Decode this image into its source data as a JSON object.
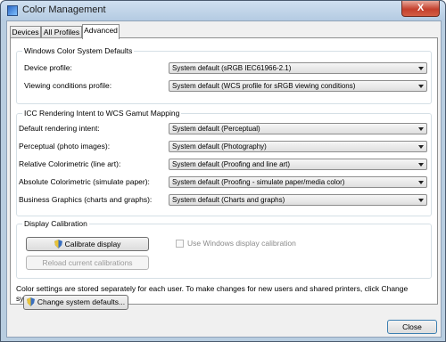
{
  "window": {
    "title": "Color Management",
    "close_glyph": "X"
  },
  "tabs": [
    {
      "label": "Devices"
    },
    {
      "label": "All Profiles"
    },
    {
      "label": "Advanced"
    }
  ],
  "wcs_defaults": {
    "title": "Windows Color System Defaults",
    "device_profile": {
      "label": "Device profile:",
      "value": "System default (sRGB IEC61966-2.1)"
    },
    "viewing_conditions": {
      "label": "Viewing conditions profile:",
      "value": "System default (WCS profile for sRGB viewing conditions)"
    }
  },
  "icc_mapping": {
    "title": "ICC Rendering Intent to WCS Gamut Mapping",
    "rows": [
      {
        "label": "Default rendering intent:",
        "value": "System default (Perceptual)"
      },
      {
        "label": "Perceptual (photo images):",
        "value": "System default (Photography)"
      },
      {
        "label": "Relative Colorimetric (line art):",
        "value": "System default (Proofing and line art)"
      },
      {
        "label": "Absolute Colorimetric (simulate paper):",
        "value": "System default (Proofing - simulate paper/media color)"
      },
      {
        "label": "Business Graphics (charts and graphs):",
        "value": "System default (Charts and graphs)"
      }
    ]
  },
  "calibration": {
    "title": "Display Calibration",
    "calibrate_button": "Calibrate display",
    "reload_button": "Reload current calibrations",
    "use_windows_calibration": "Use Windows display calibration"
  },
  "footer": {
    "note": "Color settings are stored separately for each user. To make changes for new users and shared printers, click Change system defaults.",
    "change_defaults_button": "Change system defaults...",
    "close_button": "Close"
  },
  "colors": {
    "title_bar": "#b4cbe2",
    "close_button": "#c4402d",
    "group_border": "#d5dfe5"
  }
}
